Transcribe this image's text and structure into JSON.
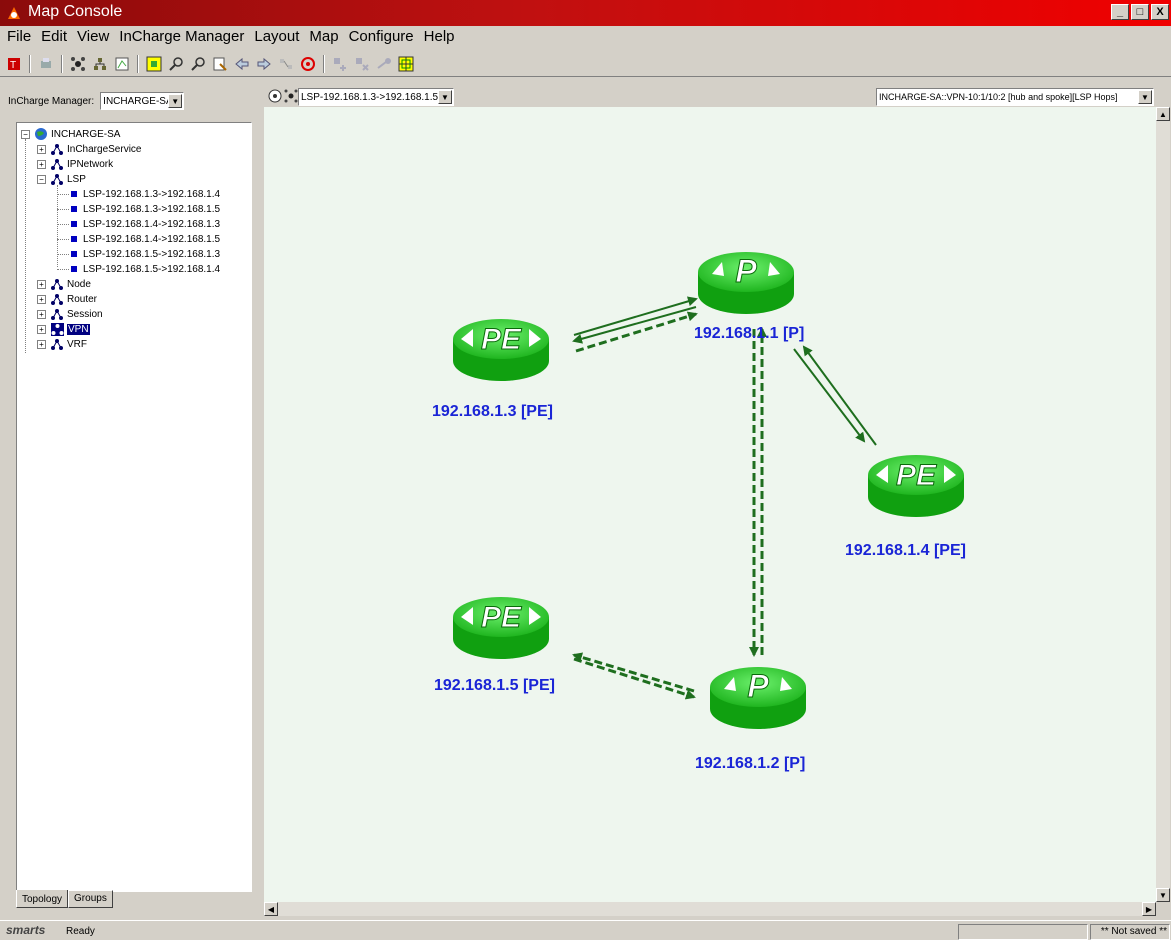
{
  "window": {
    "title": "Map Console",
    "buttons": [
      "_",
      "□",
      "X"
    ]
  },
  "menu": [
    "File",
    "Edit",
    "View",
    "InCharge Manager",
    "Layout",
    "Map",
    "Configure",
    "Help"
  ],
  "left": {
    "manager_label": "InCharge Manager:",
    "manager_value": "INCHARGE-SA",
    "tree": {
      "root": "INCHARGE-SA",
      "items": [
        {
          "label": "InChargeService"
        },
        {
          "label": "IPNetwork"
        },
        {
          "label": "LSP"
        },
        {
          "label": "Node"
        },
        {
          "label": "Router"
        },
        {
          "label": "Session"
        },
        {
          "label": "VPN"
        },
        {
          "label": "VRF"
        }
      ],
      "lsp_children": [
        "LSP-192.168.1.3->192.168.1.4",
        "LSP-192.168.1.3->192.168.1.5",
        "LSP-192.168.1.4->192.168.1.3",
        "LSP-192.168.1.4->192.168.1.5",
        "LSP-192.168.1.5->192.168.1.3",
        "LSP-192.168.1.5->192.168.1.4"
      ]
    },
    "tabs": [
      "Topology",
      "Groups"
    ]
  },
  "map": {
    "lsp_select": "LSP-192.168.1.3->192.168.1.5",
    "view_select": "INCHARGE-SA::VPN-10:1/10:2 [hub and spoke][LSP Hops]",
    "nodes": [
      {
        "id": "p1",
        "label": "192.168.1.1 [P]",
        "glyph": "P"
      },
      {
        "id": "pe3",
        "label": "192.168.1.3 [PE]",
        "glyph": "PE"
      },
      {
        "id": "pe4",
        "label": "192.168.1.4 [PE]",
        "glyph": "PE"
      },
      {
        "id": "pe5",
        "label": "192.168.1.5 [PE]",
        "glyph": "PE"
      },
      {
        "id": "p2",
        "label": "192.168.1.2 [P]",
        "glyph": "P"
      }
    ]
  },
  "status": {
    "logo": "smarts",
    "text": "Ready",
    "saved": "** Not saved **"
  },
  "colors": {
    "router_green": "#2ecc2e",
    "link_green": "#1e6e1e",
    "label_blue": "#1a25d6",
    "canvas": "#eef6ee"
  }
}
